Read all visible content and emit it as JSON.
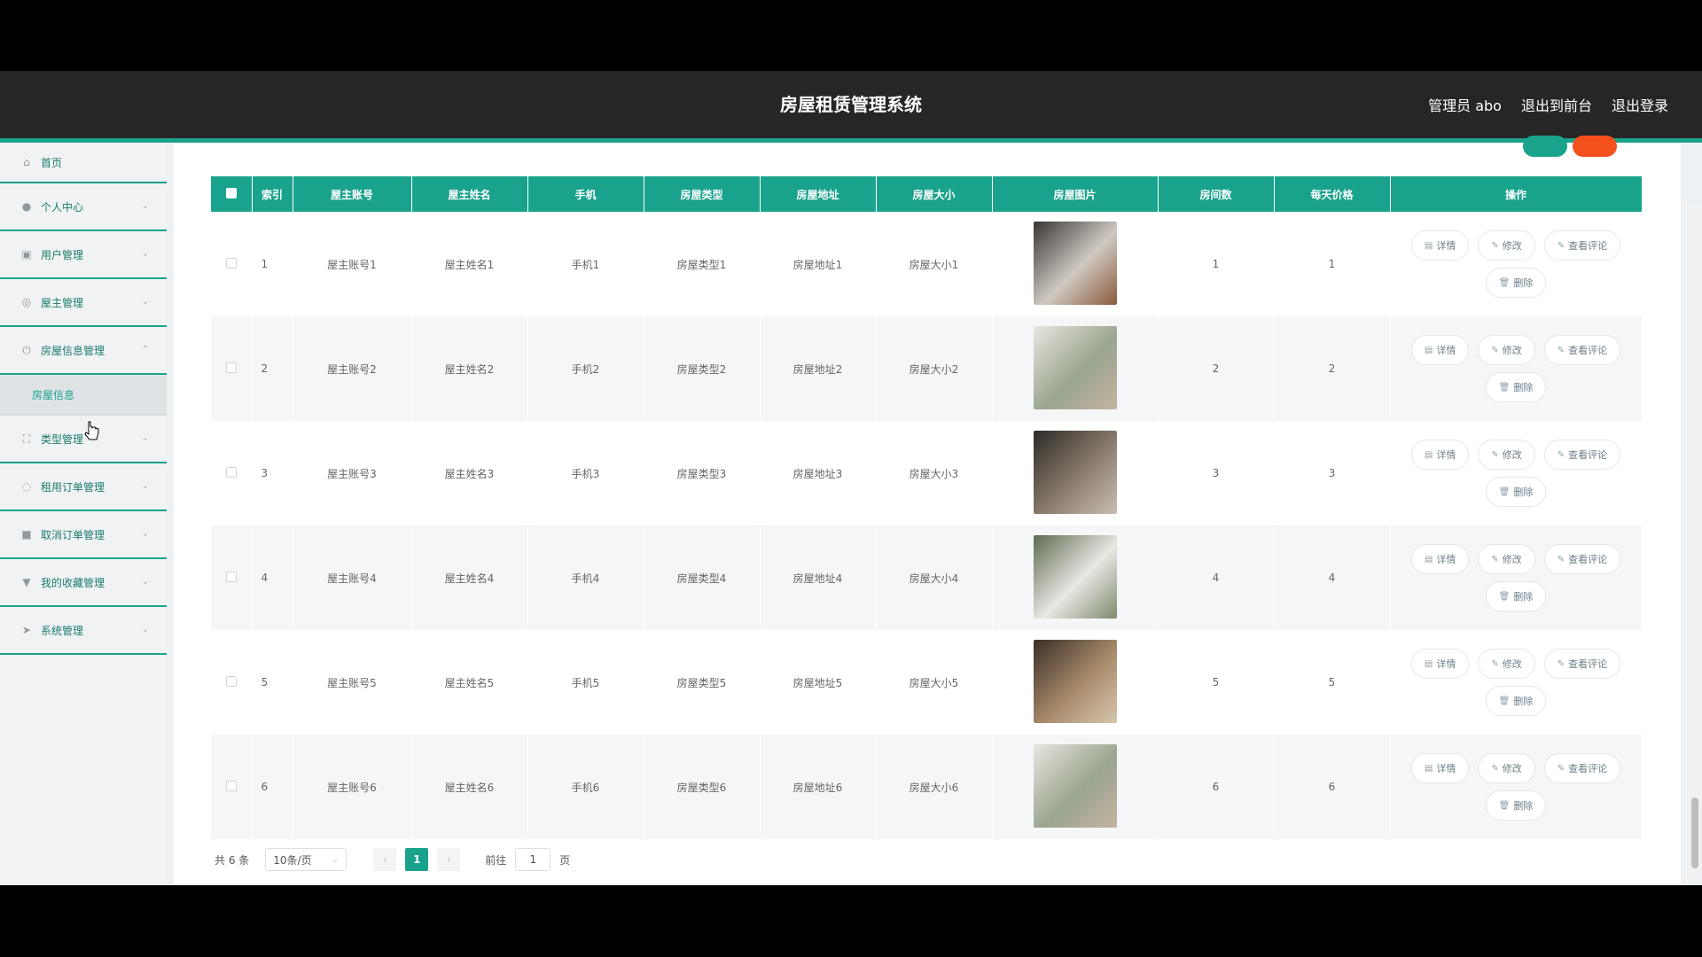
{
  "header": {
    "title": "房屋租赁管理系统",
    "user": "管理员 abo",
    "to_front": "退出到前台",
    "logout": "退出登录"
  },
  "sidebar": {
    "items": [
      {
        "label": "首页",
        "icon": "home-icon",
        "expandable": false
      },
      {
        "label": "个人中心",
        "icon": "user-icon",
        "expandable": true
      },
      {
        "label": "用户管理",
        "icon": "users-icon",
        "expandable": true
      },
      {
        "label": "屋主管理",
        "icon": "mic-icon",
        "expandable": true
      },
      {
        "label": "房屋信息管理",
        "icon": "power-icon",
        "expandable": true,
        "expanded": true
      },
      {
        "label": "类型管理",
        "icon": "fullscreen-icon",
        "expandable": true
      },
      {
        "label": "租用订单管理",
        "icon": "bulb-icon",
        "expandable": true
      },
      {
        "label": "取消订单管理",
        "icon": "briefcase-icon",
        "expandable": true
      },
      {
        "label": "我的收藏管理",
        "icon": "trophy-icon",
        "expandable": true
      },
      {
        "label": "系统管理",
        "icon": "send-icon",
        "expandable": true
      }
    ],
    "submenu": {
      "label": "房屋信息"
    }
  },
  "table": {
    "headers": [
      "",
      "索引",
      "屋主账号",
      "屋主姓名",
      "手机",
      "房屋类型",
      "房屋地址",
      "房屋大小",
      "房屋图片",
      "房间数",
      "每天价格",
      "操作"
    ],
    "rows": [
      {
        "index": "1",
        "account": "屋主账号1",
        "name": "屋主姓名1",
        "phone": "手机1",
        "type": "房屋类型1",
        "address": "房屋地址1",
        "size": "房屋大小1",
        "rooms": "1",
        "price": "1",
        "img": [
          "#3a3633",
          "#cfc9c2",
          "#8a5a3a"
        ]
      },
      {
        "index": "2",
        "account": "屋主账号2",
        "name": "屋主姓名2",
        "phone": "手机2",
        "type": "房屋类型2",
        "address": "房屋地址2",
        "size": "房屋大小2",
        "rooms": "2",
        "price": "2",
        "img": [
          "#e9e6e1",
          "#9aa58f",
          "#c4b3a2"
        ]
      },
      {
        "index": "3",
        "account": "屋主账号3",
        "name": "屋主姓名3",
        "phone": "手机3",
        "type": "房屋类型3",
        "address": "房屋地址3",
        "size": "房屋大小3",
        "rooms": "3",
        "price": "3",
        "img": [
          "#2d2a27",
          "#8b7d6e",
          "#c9beb1"
        ]
      },
      {
        "index": "4",
        "account": "屋主账号4",
        "name": "屋主姓名4",
        "phone": "手机4",
        "type": "房屋类型4",
        "address": "房屋地址4",
        "size": "房屋大小4",
        "rooms": "4",
        "price": "4",
        "img": [
          "#5e6b4f",
          "#e8e8e4",
          "#7d8a6d"
        ]
      },
      {
        "index": "5",
        "account": "屋主账号5",
        "name": "屋主姓名5",
        "phone": "手机5",
        "type": "房屋类型5",
        "address": "房屋地址5",
        "size": "房屋大小5",
        "rooms": "5",
        "price": "5",
        "img": [
          "#3b2f27",
          "#a78a6b",
          "#d7c5ae"
        ]
      },
      {
        "index": "6",
        "account": "屋主账号6",
        "name": "屋主姓名6",
        "phone": "手机6",
        "type": "房屋类型6",
        "address": "房屋地址6",
        "size": "房屋大小6",
        "rooms": "6",
        "price": "6",
        "img": [
          "#e9e6e1",
          "#9aa58f",
          "#c4b3a2"
        ]
      }
    ],
    "actions": {
      "detail": "详情",
      "edit": "修改",
      "comments": "查看评论",
      "delete": "删除"
    }
  },
  "pager": {
    "total": "共 6 条",
    "page_size": "10条/页",
    "current": "1",
    "goto_label": "前往",
    "goto_value": "1",
    "page_suffix": "页"
  },
  "colors": {
    "accent": "#1aa38c",
    "header_bg": "#262626",
    "orange": "#f4511e"
  }
}
